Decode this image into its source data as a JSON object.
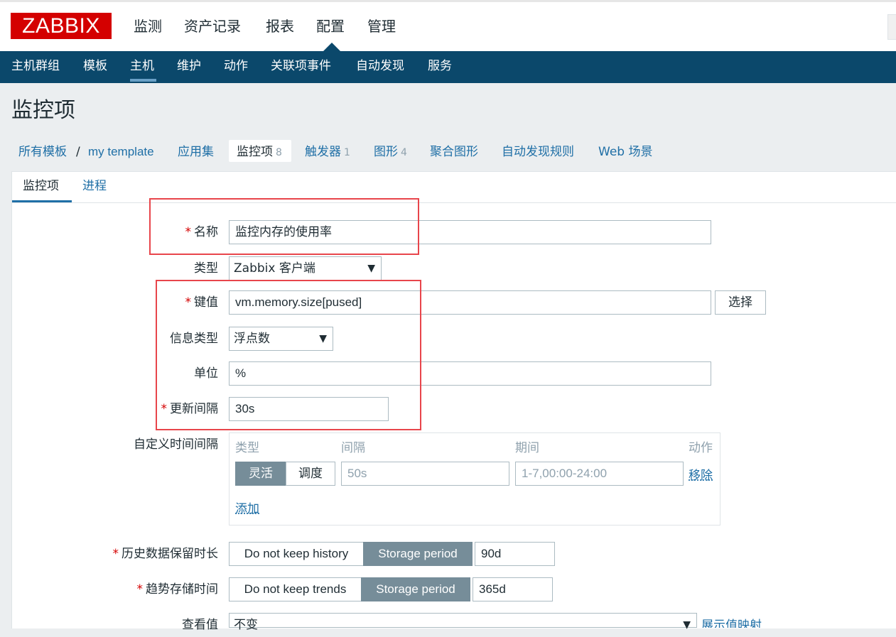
{
  "header": {
    "logo_text": "ZABBIX",
    "menu": [
      "监测",
      "资产记录",
      "报表",
      "配置",
      "管理"
    ],
    "active_menu": "配置"
  },
  "subnav": {
    "items": [
      "主机群组",
      "模板",
      "主机",
      "维护",
      "动作",
      "关联项事件",
      "自动发现",
      "服务"
    ],
    "active": "主机"
  },
  "page": {
    "title": "监控项"
  },
  "breadcrumb": {
    "all_templates": "所有模板",
    "separator": "/",
    "template_name": "my template",
    "applications": "应用集",
    "items": {
      "label": "监控项",
      "count": "8"
    },
    "triggers": {
      "label": "触发器",
      "count": "1"
    },
    "graphs": {
      "label": "图形",
      "count": "4"
    },
    "screens": "聚合图形",
    "discovery": "自动发现规则",
    "web": "Web 场景"
  },
  "tabs": {
    "item": "监控项",
    "process": "进程"
  },
  "form": {
    "required_mark": "*",
    "name": {
      "label": "名称",
      "value": "监控内存的使用率"
    },
    "type": {
      "label": "类型",
      "value": "Zabbix 客户端"
    },
    "key": {
      "label": "键值",
      "value": "vm.memory.size[pused]",
      "select_button": "选择"
    },
    "value_type": {
      "label": "信息类型",
      "value": "浮点数"
    },
    "units": {
      "label": "单位",
      "value": "%"
    },
    "update_interval": {
      "label": "更新间隔",
      "value": "30s"
    },
    "custom_intervals": {
      "label": "自定义时间间隔",
      "col_type": "类型",
      "col_interval": "间隔",
      "col_period": "期间",
      "col_action": "动作",
      "flexible": "灵活",
      "scheduling": "调度",
      "interval_placeholder": "50s",
      "period_placeholder": "1-7,00:00-24:00",
      "remove": "移除",
      "add": "添加"
    },
    "history": {
      "label": "历史数据保留时长",
      "no_keep": "Do not keep history",
      "storage": "Storage period",
      "value": "90d"
    },
    "trends": {
      "label": "趋势存储时间",
      "no_keep": "Do not keep trends",
      "storage": "Storage period",
      "value": "365d"
    },
    "show_value": {
      "label": "查看值",
      "value": "不变",
      "mapping_link": "展示值映射"
    }
  },
  "colors": {
    "brand_red": "#d40000",
    "nav_blue": "#0b486b",
    "link_blue": "#1f6fa6",
    "segment_active": "#768d99",
    "highlight_red": "#e8454b"
  }
}
